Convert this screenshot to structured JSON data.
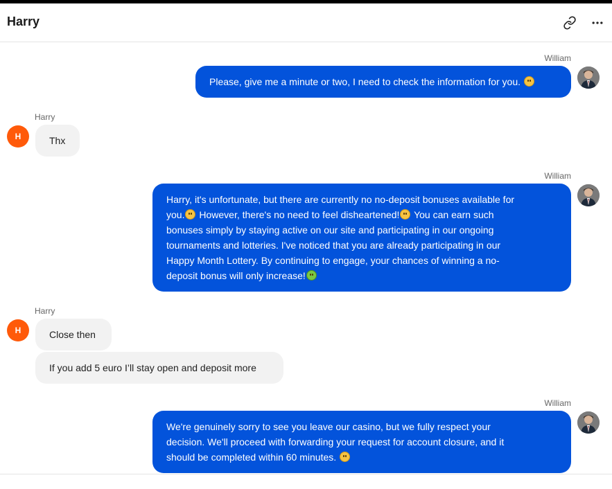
{
  "header": {
    "title": "Harry",
    "icons": {
      "link": "link-icon",
      "more": "more-horizontal-icon"
    }
  },
  "colors": {
    "agent_bubble": "#0353db",
    "customer_bubble": "#f2f2f2",
    "customer_avatar": "#ff5a0a",
    "agent_avatar": "#8c8c8c"
  },
  "messages": [
    {
      "sender": "William",
      "lines": [
        "Please, give me a minute or two, I need to check the information for you."
      ],
      "emoji": "smiling-face-icon"
    },
    {
      "sender": "Harry",
      "avatar_letter": "H",
      "text": "Thx"
    },
    {
      "sender": "William",
      "lines": [
        "Harry, it's unfortunate, but there are currently no no-deposit bonuses available for",
        "you.",
        " However, there's no need to feel disheartened!",
        " You can earn such",
        "bonuses simply by staying active on our site and participating in our ongoing",
        "tournaments and lotteries. I've noticed that you are already participating in our",
        "Happy Month Lottery. By continuing to engage, your chances of winning a no-",
        "deposit bonus will only increase!"
      ]
    },
    {
      "sender": "Harry",
      "avatar_letter": "H",
      "texts": [
        "Close then",
        "If you add 5 euro I’ll stay open and deposit more"
      ]
    },
    {
      "sender": "William",
      "lines": [
        "We're genuinely sorry to see you leave our casino, but we fully respect your",
        "decision. We'll proceed with forwarding your request for account closure, and it",
        "should be completed within 60 minutes."
      ]
    }
  ]
}
